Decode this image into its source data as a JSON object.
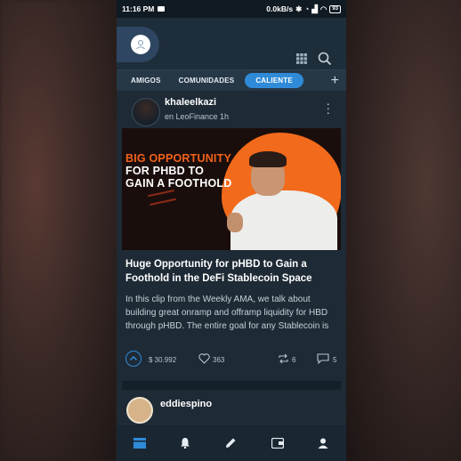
{
  "statusbar": {
    "time": "11:16 PM",
    "speed": "0.0kB/s",
    "battery": "93"
  },
  "tabs": [
    {
      "label": "AMIGOS"
    },
    {
      "label": "COMUNIDADES"
    },
    {
      "label": "CALIENTE"
    }
  ],
  "post": {
    "author": "khaleelkazi",
    "meta": "en LeoFinance 1h",
    "thumbnail": {
      "line1": "BIG OPPORTUNITY",
      "line2": "FOR PHBD TO",
      "line3": "GAIN A FOOTHOLD"
    },
    "title": "Huge Opportunity for pHBD to Gain a Foothold in the DeFi Stablecoin Space",
    "body": "In this clip from the Weekly AMA, we talk about building great onramp and offramp liquidity for HBD through pHBD. The entire goal for any Stablecoin is",
    "payout": "$ 30.992",
    "likes": "363",
    "reblogs": "6",
    "comments": "5"
  },
  "next_post": {
    "author": "eddiespino"
  },
  "colors": {
    "accent": "#2f8bd8",
    "background": "#1e2a35",
    "thumbnail_orange": "#f26a1b"
  }
}
